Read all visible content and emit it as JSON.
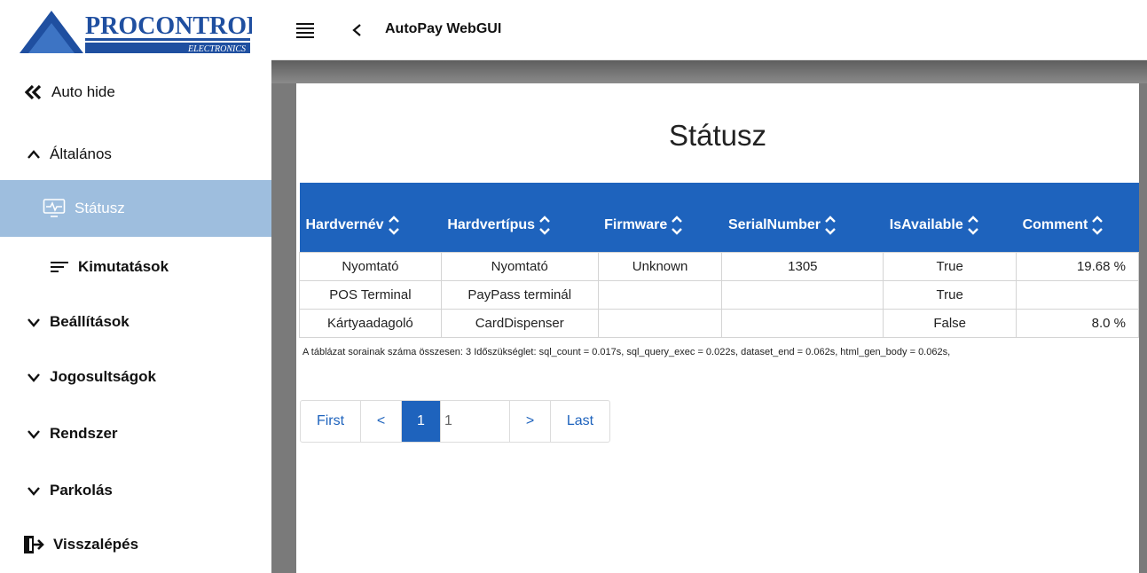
{
  "logo": {
    "brand": "PROCONTROL",
    "sub": "ELECTRONICS"
  },
  "sidebar": {
    "items": [
      {
        "label": "Auto hide",
        "icon": "double-chevron-left-icon"
      },
      {
        "label": "Általános",
        "icon": "chevron-up-icon"
      },
      {
        "label": "Státusz",
        "icon": "monitor-pulse-icon"
      },
      {
        "label": "Kimutatások",
        "icon": "list-lines-icon"
      },
      {
        "label": "Beállítások",
        "icon": "chevron-down-icon"
      },
      {
        "label": "Jogosultságok",
        "icon": "chevron-down-icon"
      },
      {
        "label": "Rendszer",
        "icon": "chevron-down-icon"
      },
      {
        "label": "Parkolás",
        "icon": "chevron-down-icon"
      },
      {
        "label": "Visszalépés",
        "icon": "exit-door-icon"
      }
    ]
  },
  "topbar": {
    "title": "AutoPay WebGUI"
  },
  "page": {
    "title": "Státusz"
  },
  "table": {
    "columns": [
      "Hardvernév",
      "Hardvertípus",
      "Firmware",
      "SerialNumber",
      "IsAvailable",
      "Comment"
    ],
    "rows": [
      [
        "Nyomtató",
        "Nyomtató",
        "Unknown",
        "1305",
        "True",
        "19.68 %"
      ],
      [
        "POS Terminal",
        "PayPass terminál",
        "",
        "",
        "True",
        ""
      ],
      [
        "Kártyaadagoló",
        "CardDispenser",
        "",
        "",
        "False",
        "8.0 %"
      ]
    ],
    "summary": "A táblázat sorainak száma összesen: 3   Időszükséglet: sql_count = 0.017s, sql_query_exec = 0.022s, dataset_end = 0.062s, html_gen_body = 0.062s,"
  },
  "pager": {
    "first": "First",
    "prev": "<",
    "current": "1",
    "input_value": "1",
    "next": ">",
    "last": "Last"
  },
  "colors": {
    "accent": "#1e63bd",
    "active_item": "#9ebede",
    "logo_blue": "#1f4fa0"
  }
}
